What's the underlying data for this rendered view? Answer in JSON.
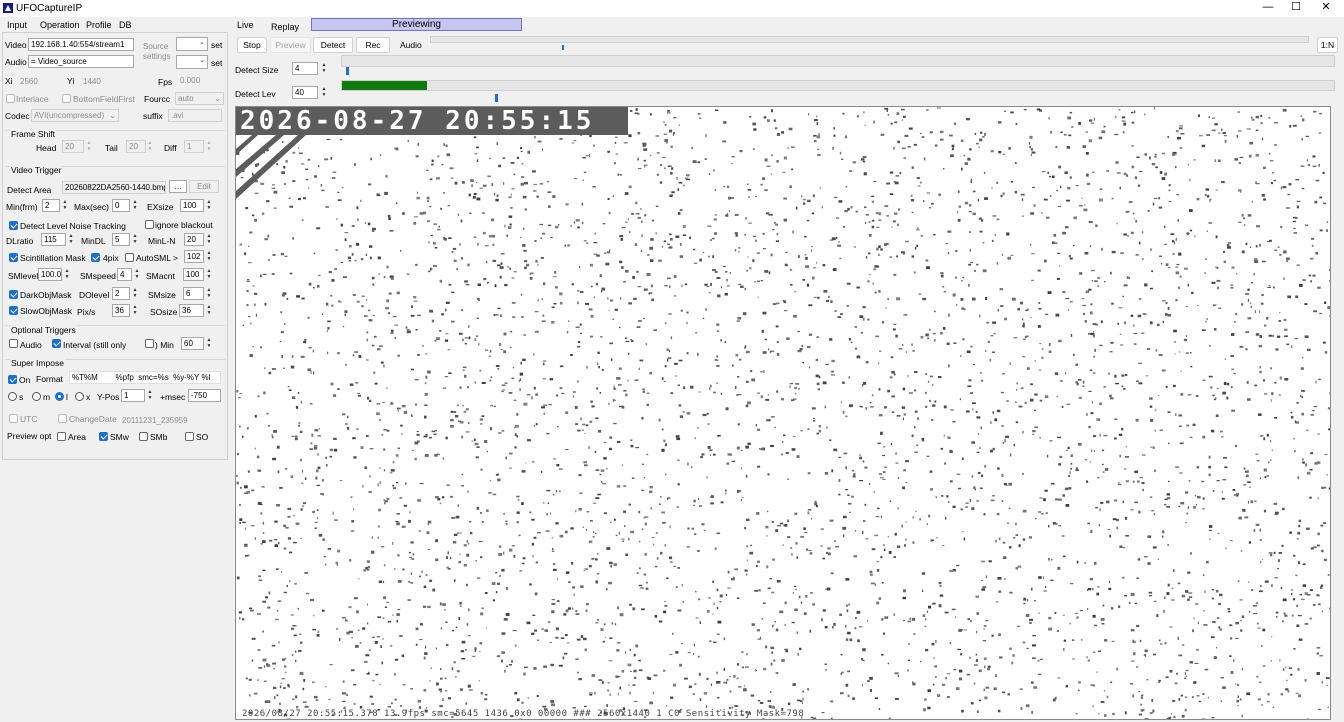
{
  "window": {
    "title": "UFOCaptureIP",
    "minimize": "—",
    "maximize": "☐",
    "close": "✕"
  },
  "left_tabs": [
    "Input",
    "Operation",
    "Profile",
    "DB"
  ],
  "input": {
    "video_label": "Video",
    "video_value": "192.168.1.40:554/stream1",
    "audio_label": "Audio",
    "audio_value": "= Video_source",
    "source_settings": "Source settings",
    "set1": "set",
    "set2": "set",
    "xi_label": "Xi",
    "xi_value": "2560",
    "yi_label": "Yi",
    "yi_value": "1440",
    "fps_label": "Fps",
    "fps_value": "0.000",
    "interlace_label": "Interlace",
    "bottomfield_label": "BottomFieldFirst",
    "fourcc_label": "Fourcc",
    "fourcc_value": "auto",
    "codec_label": "Codec",
    "codec_value": "AVI(uncompressed)",
    "suffix_label": "suffix",
    "suffix_value": ".avi"
  },
  "frame_shift": {
    "title": "Frame Shift",
    "head_label": "Head",
    "head_value": "20",
    "tail_label": "Tail",
    "tail_value": "20",
    "diff_label": "Diff",
    "diff_value": "1"
  },
  "video_trigger": {
    "title": "Video Trigger",
    "detect_area_label": "Detect Area",
    "detect_area_value": "20260822DA2560-1440.bmp",
    "browse": "...",
    "edit": "Edit",
    "minfrm_label": "Min(frm)",
    "minfrm_value": "2",
    "maxsec_label": "Max(sec)",
    "maxsec_value": "0",
    "exsize_label": "EXsize",
    "exsize_value": "100",
    "noise_tracking_label": "Detect Level Noise Tracking",
    "ignore_blackout_label": "ignore blackout",
    "dlratio_label": "DLratio",
    "dlratio_value": "115",
    "mindl_label": "MinDL",
    "mindl_value": "5",
    "minln_label": "MinL-N",
    "minln_value": "20",
    "scint_label": "Scintillation Mask",
    "fourpix_label": "4pix",
    "autosml_label": "AutoSML >",
    "autosml_value": "102",
    "smlevel_label": "SMlevel",
    "smlevel_value": "100.0",
    "smspeed_label": "SMspeed",
    "smspeed_value": "4",
    "smacnt_label": "SMacnt",
    "smacnt_value": "100",
    "darkobj_label": "DarkObjMask",
    "dolevel_label": "DOlevel",
    "dolevel_value": "2",
    "smsize_label": "SMsize",
    "smsize_value": "6",
    "slowobj_label": "SlowObjMask",
    "pixs_label": "Pix/s",
    "pixs_value": "36",
    "sosize_label": "SOsize",
    "sosize_value": "36"
  },
  "optional_triggers": {
    "title": "Optional Triggers",
    "audio_label": "Audio",
    "interval_label": "Interval (still only",
    "min_label": ") Min",
    "min_value": "60"
  },
  "super_impose": {
    "title": "Super Impose",
    "on_label": "On",
    "format_label": "Format",
    "format_value": "%T%M        %pfp  smc=%s  %y-%Y %l",
    "s_label": "s",
    "m_label": "m",
    "l_label": "l",
    "x_label": "x",
    "ypos_label": "Y-Pos",
    "ypos_value": "1",
    "msec_label": "+msec",
    "msec_value": "-750",
    "utc_label": "UTC",
    "changedate_label": "ChangeDate",
    "changedate_value": "20111231_235959"
  },
  "preview_opt": {
    "label": "Preview opt",
    "area_label": "Area",
    "smw_label": "SMw",
    "smb_label": "SMb",
    "so_label": "SO"
  },
  "right_tabs": [
    "Live",
    "Replay"
  ],
  "status": "Previewing",
  "toolbar": {
    "stop": "Stop",
    "preview": "Preview",
    "detect": "Detect",
    "rec": "Rec",
    "audio": "Audio",
    "ratio": "1:N"
  },
  "sliders": {
    "detect_size_label": "Detect Size",
    "detect_size_value": "4",
    "detect_lev_label": "Detect Lev",
    "detect_lev_value": "40",
    "level_bar_color": "#0f7b0f",
    "level_bar_fraction": 0.086
  },
  "video": {
    "timestamp": "2026-08-27 20:55:15",
    "footer": "2026/08/27 20:55:15.378      13.9fps smc=5645   1436 0x0                 00000 ###  2560x1440  1 C0  Sensitivity    Mask=798"
  },
  "colors": {
    "accent": "#1f6fc5",
    "previewing_bg": "#c6c6f0",
    "stamp_bg": "#5c5c5c"
  }
}
